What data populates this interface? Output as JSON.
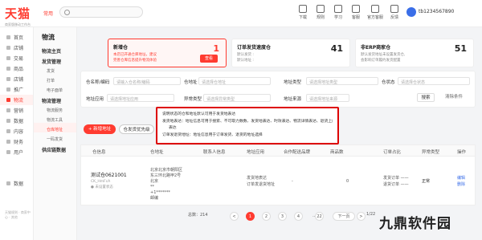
{
  "topbar": {
    "logo": "天猫",
    "logo_sub": "商家版移动工作台",
    "nav_tag": "常用",
    "search_placeholder": "",
    "tools": [
      {
        "label": "下载",
        "icon": "download-icon"
      },
      {
        "label": "规则",
        "icon": "rules-icon"
      },
      {
        "label": "学习",
        "icon": "learn-icon"
      },
      {
        "label": "客服",
        "icon": "service-icon"
      },
      {
        "label": "官方客服",
        "icon": "official-service-icon"
      },
      {
        "label": "反馈",
        "icon": "feedback-icon"
      }
    ],
    "user": "tb1234567890"
  },
  "sidebar": {
    "items": [
      "首页",
      "店铺",
      "交易",
      "商品",
      "店铺",
      "推广",
      "物流",
      "营销",
      "数据",
      "内容",
      "财务",
      "用户",
      "",
      "",
      "数据"
    ],
    "footer": "天猫规则 · 商家中心 · 其他"
  },
  "subnav": {
    "title": "物流",
    "groups": [
      {
        "label": "物流主页",
        "items": []
      },
      {
        "label": "发货管理",
        "items": [
          "发货",
          "打单",
          "电子面单"
        ]
      },
      {
        "label": "物流管理",
        "items": [
          "物流服务",
          "物流工具",
          "仓库地址",
          "一码发货"
        ]
      },
      {
        "label": "供应链数据",
        "items": []
      }
    ]
  },
  "cards": [
    {
      "title": "新增仓",
      "num": "1",
      "d1": "本店已开通仓库地址，建议",
      "d2": "完善仓库信息提升物流体验",
      "btn": "查看"
    },
    {
      "title": "订单发货速度仓",
      "num": "41",
      "d1": "默认发货 :",
      "d2": "默认地址 :"
    },
    {
      "title": "非ERP商家仓",
      "num": "51",
      "d1": "默认发货地址未设置发货仓,",
      "d2": "会影响订单履约发货配置"
    }
  ],
  "filters": {
    "row1": [
      {
        "label": "仓名称/编码",
        "ph": "请输入仓名称/编码"
      },
      {
        "label": "仓地址",
        "ph": "请选择仓地址"
      },
      {
        "label": "地址类型",
        "ph": "请选择地址类型"
      },
      {
        "label": "仓状态",
        "ph": "请选择仓状态"
      }
    ],
    "row2": [
      {
        "label": "地址应用",
        "ph": "请选择地址应用"
      },
      {
        "label": "异常类型",
        "ph": "请选择异常类型"
      },
      {
        "label": "地址来源",
        "ph": "请选择地址来源"
      }
    ],
    "search": "搜索",
    "reset": "清除条件"
  },
  "tip": {
    "lines": [
      "说明状态的仓和地址默认可用于发货地表达",
      "发货地表达：地址信息可用于搜索、不可取力数数、发货地表达、时效表达、物流详情表达、退货上门地址",
      "表达",
      "订单发退货地址：地址信息用于订单发货、退货的地址选择"
    ]
  },
  "actions": {
    "add": "+ 新增地址",
    "switch": "仓发货优先级"
  },
  "table": {
    "headers": [
      "仓信息",
      "仓地址",
      "联系人信息",
      "地址应用",
      "合作配送品牌",
      "商品数",
      "订单占比",
      "异常类型",
      "操作"
    ],
    "rows": [
      {
        "name": "测试仓0621001",
        "code": "CK_HmFcA",
        "status": "● 未设置状态",
        "addr1": "北京北京市朝阳区",
        "addr2": "东三环北路甲2号",
        "addr3": "北京",
        "contact": "**",
        "phone": "+1*******",
        "zip": "邮编",
        "use1": "发货地表达",
        "use2": "订单发退货地址",
        "brand": "-",
        "count": "0",
        "share1": "发货订单 ——",
        "share2": "退货订单 ——",
        "issue": "正常",
        "op1": "编辑",
        "op2": "删除"
      }
    ]
  },
  "pager": {
    "total": "总数：214",
    "pages": [
      "<",
      "1",
      "2",
      "3",
      "4",
      "...",
      "22",
      ">"
    ],
    "next": "下一页",
    "size": "1/22"
  },
  "watermark": "九鼎软件园"
}
